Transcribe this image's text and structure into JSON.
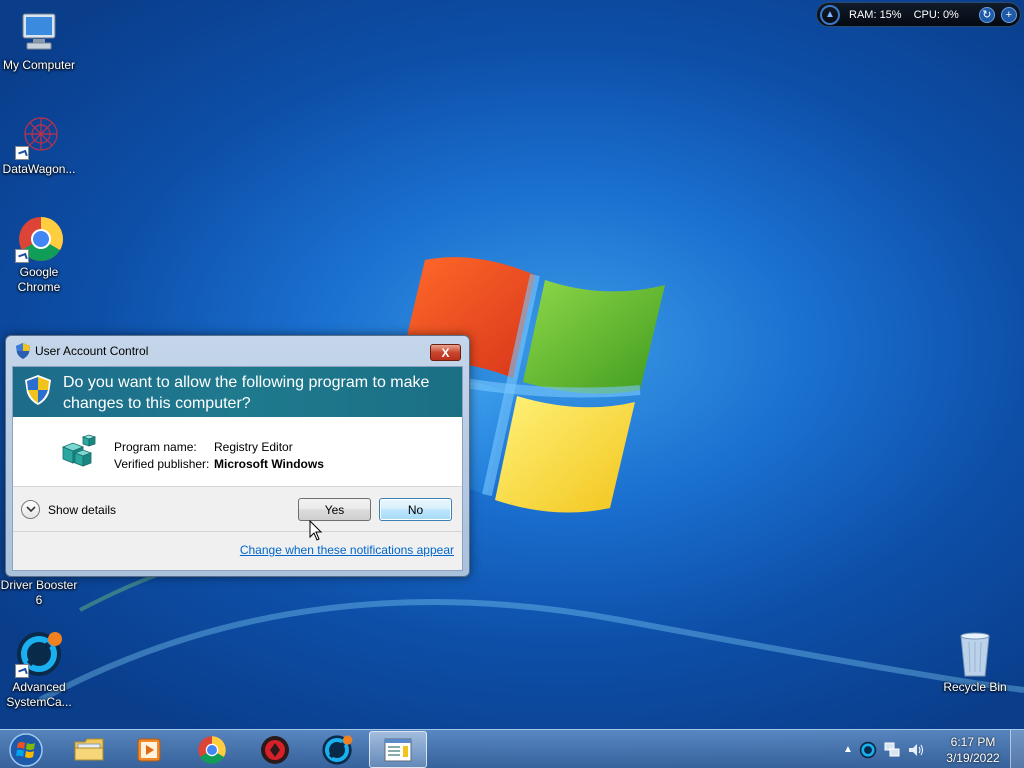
{
  "desktop": {
    "icons": [
      {
        "label": "My Computer"
      },
      {
        "label": "DataWagon..."
      },
      {
        "label": "Google Chrome"
      },
      {
        "label": "Driver Booster 6"
      },
      {
        "label": "Advanced SystemCa..."
      },
      {
        "label": "Recycle Bin"
      }
    ]
  },
  "gadget": {
    "ram_label": "RAM:",
    "ram_value": "15%",
    "cpu_label": "CPU:",
    "cpu_value": "0%"
  },
  "uac": {
    "title": "User Account Control",
    "close_label": "X",
    "question": "Do you want to allow the following program to make changes to this computer?",
    "program_name_label": "Program name:",
    "program_name": "Registry Editor",
    "publisher_label": "Verified publisher:",
    "publisher": "Microsoft Windows",
    "show_details": "Show details",
    "yes_label": "Yes",
    "no_label": "No",
    "notifications_link": "Change when these notifications appear"
  },
  "taskbar": {
    "time": "6:17 PM",
    "date": "3/19/2022"
  },
  "colors": {
    "desktop_blue": "#1a6fcf",
    "uac_banner": "#1f7a8e",
    "link": "#0066cc"
  }
}
